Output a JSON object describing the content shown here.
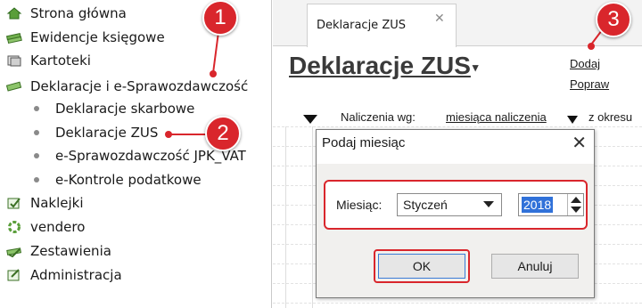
{
  "sidebar": {
    "items": [
      {
        "label": "Strona główna",
        "icon": "home-icon"
      },
      {
        "label": "Ewidencje księgowe",
        "icon": "books-icon"
      },
      {
        "label": "Kartoteki",
        "icon": "cards-icon"
      },
      {
        "label": "Deklaracje i e-Sprawozdawczość",
        "icon": "declarations-icon"
      }
    ],
    "subitems": [
      {
        "label": "Deklaracje skarbowe"
      },
      {
        "label": "Deklaracje ZUS"
      },
      {
        "label": "e-Sprawozdawczość JPK_VAT"
      },
      {
        "label": "e-Kontrole podatkowe"
      }
    ],
    "items_after": [
      {
        "label": "Naklejki",
        "icon": "label-icon"
      },
      {
        "label": "vendero",
        "icon": "vendero-icon"
      },
      {
        "label": "Zestawienia",
        "icon": "reports-icon"
      },
      {
        "label": "Administracja",
        "icon": "admin-icon"
      }
    ]
  },
  "callouts": {
    "one": "1",
    "two": "2",
    "three": "3"
  },
  "tab": {
    "label": "Deklaracje ZUS",
    "close": "✕"
  },
  "page": {
    "title": "Deklaracje ZUS",
    "caret": "▾"
  },
  "actions": {
    "add": "Dodaj",
    "edit": "Popraw"
  },
  "filter": {
    "label": "Naliczenia wg:",
    "value": "miesiąca naliczenia",
    "period_label": "z okresu"
  },
  "dialog": {
    "title": "Podaj miesiąc",
    "close": "✕",
    "field_label": "Miesiąc:",
    "month": "Styczeń",
    "year": "2018",
    "ok": "OK",
    "cancel": "Anuluj"
  },
  "colors": {
    "callout": "#d9262c",
    "selection": "#3071d9",
    "icon_green": "#5a9e3a"
  }
}
